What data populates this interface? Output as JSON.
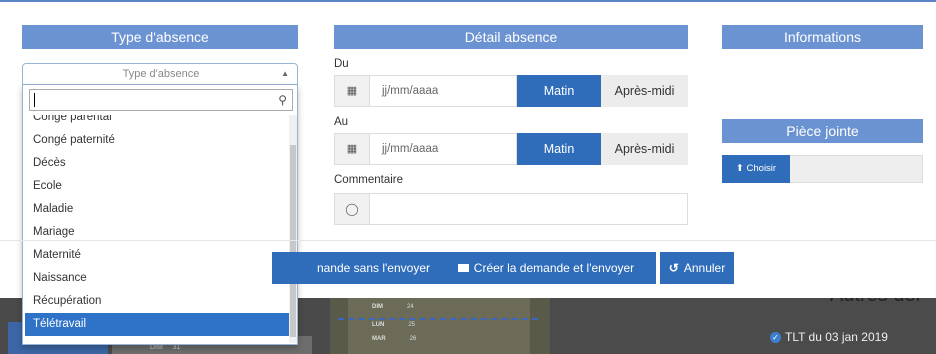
{
  "type_absence": {
    "header": "Type d'absence",
    "placeholder": "Type d'absence",
    "search_value": "",
    "options": [
      "Congé parental",
      "Congé paternité",
      "Décès",
      "Ecole",
      "Maladie",
      "Mariage",
      "Maternité",
      "Naissance",
      "Récupération",
      "Télétravail"
    ],
    "selected": "Télétravail"
  },
  "detail": {
    "header": "Détail absence",
    "du_label": "Du",
    "au_label": "Au",
    "date_placeholder": "jj/mm/aaaa",
    "matin_label": "Matin",
    "apres_midi_label": "Après-midi",
    "commentaire_label": "Commentaire"
  },
  "informations": {
    "header": "Informations"
  },
  "piece_jointe": {
    "header": "Pièce jointe",
    "choose_label": "Choisir"
  },
  "footer": {
    "save_no_send_label": "nande sans l'envoyer",
    "create_send_label": "Créer la demande et l'envoyer",
    "cancel_label": "Annuler"
  },
  "background": {
    "autres_title": "Autres der",
    "tlt_item": "TLT du 03 jan 2019",
    "cal_rows": [
      {
        "day": "DIM",
        "num": "24"
      },
      {
        "day": "LUN",
        "num": "25"
      },
      {
        "day": "MAR",
        "num": "26"
      }
    ],
    "left_cal": {
      "day": "DIM",
      "num": "31"
    }
  },
  "colors": {
    "header_bg": "#6b93d2",
    "primary_btn": "#2f6dbb",
    "selected_item": "#2f73c9"
  }
}
